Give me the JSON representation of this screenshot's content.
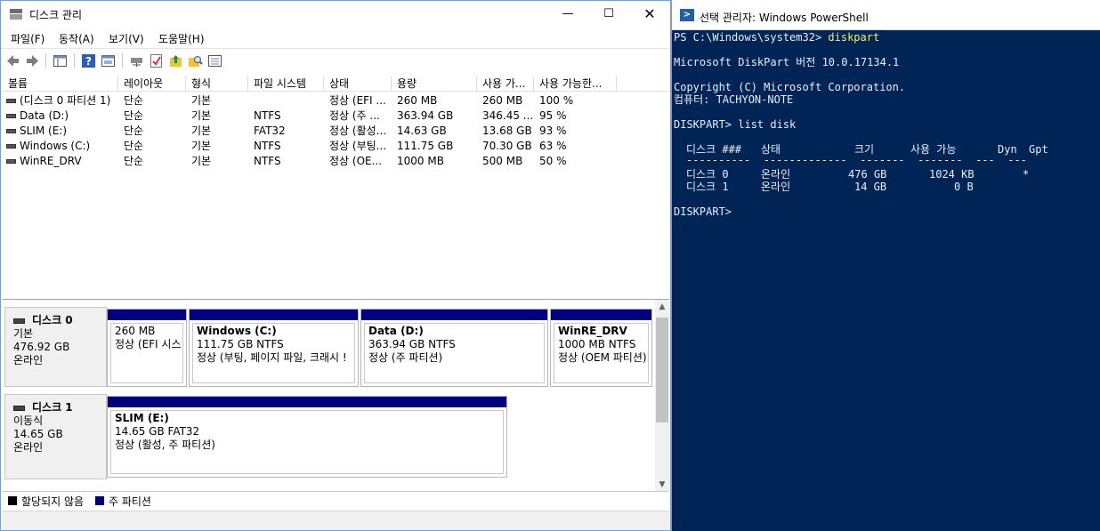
{
  "disk_mgmt": {
    "title": "디스크 관리",
    "menu": [
      "파일(F)",
      "동작(A)",
      "보기(V)",
      "도움말(H)"
    ],
    "columns": [
      "볼륨",
      "레이아웃",
      "형식",
      "파일 시스템",
      "상태",
      "용량",
      "사용 가...",
      "사용 가능한..."
    ],
    "volumes": [
      {
        "name": "(디스크 0 파티션 1)",
        "layout": "단순",
        "type": "기본",
        "fs": "",
        "status": "정상 (EFI ...",
        "capacity": "260 MB",
        "free": "260 MB",
        "pct": "100 %"
      },
      {
        "name": "Data (D:)",
        "layout": "단순",
        "type": "기본",
        "fs": "NTFS",
        "status": "정상 (주 ...",
        "capacity": "363.94 GB",
        "free": "346.45 ...",
        "pct": "95 %"
      },
      {
        "name": "SLIM (E:)",
        "layout": "단순",
        "type": "기본",
        "fs": "FAT32",
        "status": "정상 (활성...",
        "capacity": "14.63 GB",
        "free": "13.68 GB",
        "pct": "93 %"
      },
      {
        "name": "Windows (C:)",
        "layout": "단순",
        "type": "기본",
        "fs": "NTFS",
        "status": "정상 (부팅...",
        "capacity": "111.75 GB",
        "free": "70.30 GB",
        "pct": "63 %"
      },
      {
        "name": "WinRE_DRV",
        "layout": "단순",
        "type": "기본",
        "fs": "NTFS",
        "status": "정상 (OE...",
        "capacity": "1000 MB",
        "free": "500 MB",
        "pct": "50 %"
      }
    ],
    "disks": [
      {
        "name": "디스크 0",
        "kind": "기본",
        "size": "476.92 GB",
        "state": "온라인",
        "partitions": [
          {
            "name": "",
            "line1": "260 MB",
            "line2": "정상 (EFI 시스"
          },
          {
            "name": "Windows  (C:)",
            "line1": "111.75 GB NTFS",
            "line2": "정상 (부팅, 페이지 파일, 크래시 !"
          },
          {
            "name": "Data  (D:)",
            "line1": "363.94 GB NTFS",
            "line2": "정상 (주 파티션)"
          },
          {
            "name": "WinRE_DRV",
            "line1": "1000 MB NTFS",
            "line2": "정상 (OEM 파티션)"
          }
        ]
      },
      {
        "name": "디스크 1",
        "kind": "이동식",
        "size": "14.65 GB",
        "state": "온라인",
        "partitions": [
          {
            "name": "SLIM  (E:)",
            "line1": "14.65 GB FAT32",
            "line2": "정상 (활성, 주 파티션)"
          }
        ]
      }
    ],
    "legend": [
      {
        "label": "할당되지 않음",
        "color": "#000000"
      },
      {
        "label": "주 파티션",
        "color": "#00007f"
      }
    ]
  },
  "powershell": {
    "title": "선택 관리자: Windows PowerShell",
    "prompt": "PS C:\\Windows\\system32> ",
    "command": "diskpart",
    "version_line": "Microsoft DiskPart 버전 10.0.17134.1",
    "copyright_line": "Copyright (C) Microsoft Corporation.",
    "computer_line": "컴퓨터: TACHYON-NOTE",
    "diskpart_cmd": "DISKPART> list disk",
    "table_header": {
      "disk": "디스크 ###",
      "status": "상태",
      "size": "크기",
      "free": "사용 가능",
      "dyn": "Dyn",
      "gpt": "Gpt"
    },
    "table_rows": [
      {
        "disk": "디스크 0",
        "status": "온라인",
        "size": "476 GB",
        "free": "1024 KB",
        "dyn": "",
        "gpt": "*"
      },
      {
        "disk": "디스크 1",
        "status": "온라인",
        "size": "14 GB",
        "free": "0 B",
        "dyn": "",
        "gpt": ""
      }
    ],
    "final_prompt": "DISKPART>"
  }
}
